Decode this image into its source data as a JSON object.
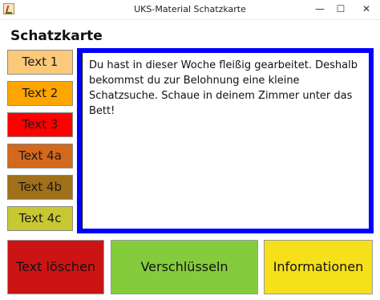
{
  "window": {
    "title": "UKS-Material Schatzkarte",
    "minimize_glyph": "—",
    "maximize_glyph": "☐",
    "close_glyph": "✕",
    "icon": "app-icon"
  },
  "page": {
    "title": "Schatzkarte"
  },
  "sidebar": {
    "items": [
      {
        "label": "Text 1",
        "color": "#fbc97a"
      },
      {
        "label": "Text 2",
        "color": "#ffa500"
      },
      {
        "label": "Text 3",
        "color": "#ff0000"
      },
      {
        "label": "Text 4a",
        "color": "#d2691e"
      },
      {
        "label": "Text 4b",
        "color": "#a0701a"
      },
      {
        "label": "Text 4c",
        "color": "#c8c832"
      }
    ]
  },
  "editor": {
    "border_color": "#0000ff",
    "text": "Du hast in dieser Woche fleißig gearbeitet. Deshalb bekommst du zur Belohnung eine kleine Schatzsuche. Schaue in deinem Zimmer unter das Bett!"
  },
  "actions": {
    "clear": {
      "label": "Text löschen",
      "color": "#cc1414"
    },
    "encrypt": {
      "label": "Verschlüsseln",
      "color": "#84cc3c"
    },
    "info": {
      "label": "Informationen",
      "color": "#f5e01a"
    }
  }
}
